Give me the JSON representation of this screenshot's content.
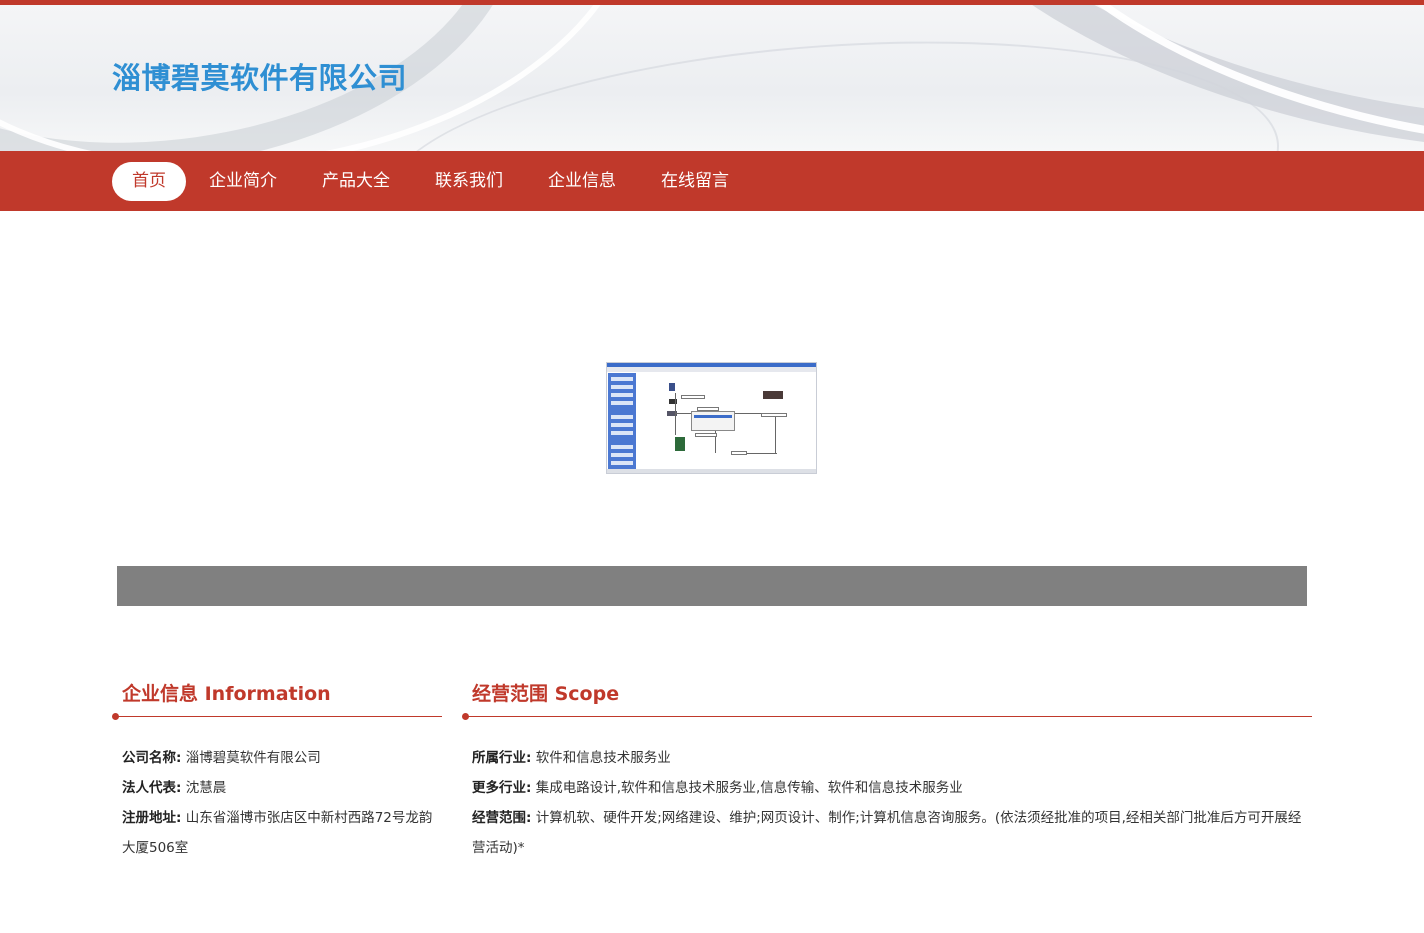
{
  "header": {
    "site_title": "淄博碧莫软件有限公司"
  },
  "nav": {
    "items": [
      {
        "label": "首页",
        "active": true
      },
      {
        "label": "企业简介"
      },
      {
        "label": "产品大全"
      },
      {
        "label": "联系我们"
      },
      {
        "label": "企业信息"
      },
      {
        "label": "在线留言"
      }
    ]
  },
  "company_info": {
    "title": "企业信息 Information",
    "name_label": "公司名称:",
    "name_value": "淄博碧莫软件有限公司",
    "rep_label": "法人代表:",
    "rep_value": "沈慧晨",
    "addr_label": "注册地址:",
    "addr_value": "山东省淄博市张店区中新村西路72号龙韵大厦506室"
  },
  "scope": {
    "title": "经营范围 Scope",
    "industry_label": "所属行业:",
    "industry_value": "软件和信息技术服务业",
    "more_label": "更多行业:",
    "more_value": "集成电路设计,软件和信息技术服务业,信息传输、软件和信息技术服务业",
    "scope_label": "经营范围:",
    "scope_value": "计算机软、硬件开发;网络建设、维护;网页设计、制作;计算机信息咨询服务。(依法须经批准的项目,经相关部门批准后方可开展经营活动)*"
  },
  "colors": {
    "accent": "#c0392b",
    "title_blue": "#2f8fd3",
    "bar_gray": "#808080"
  }
}
